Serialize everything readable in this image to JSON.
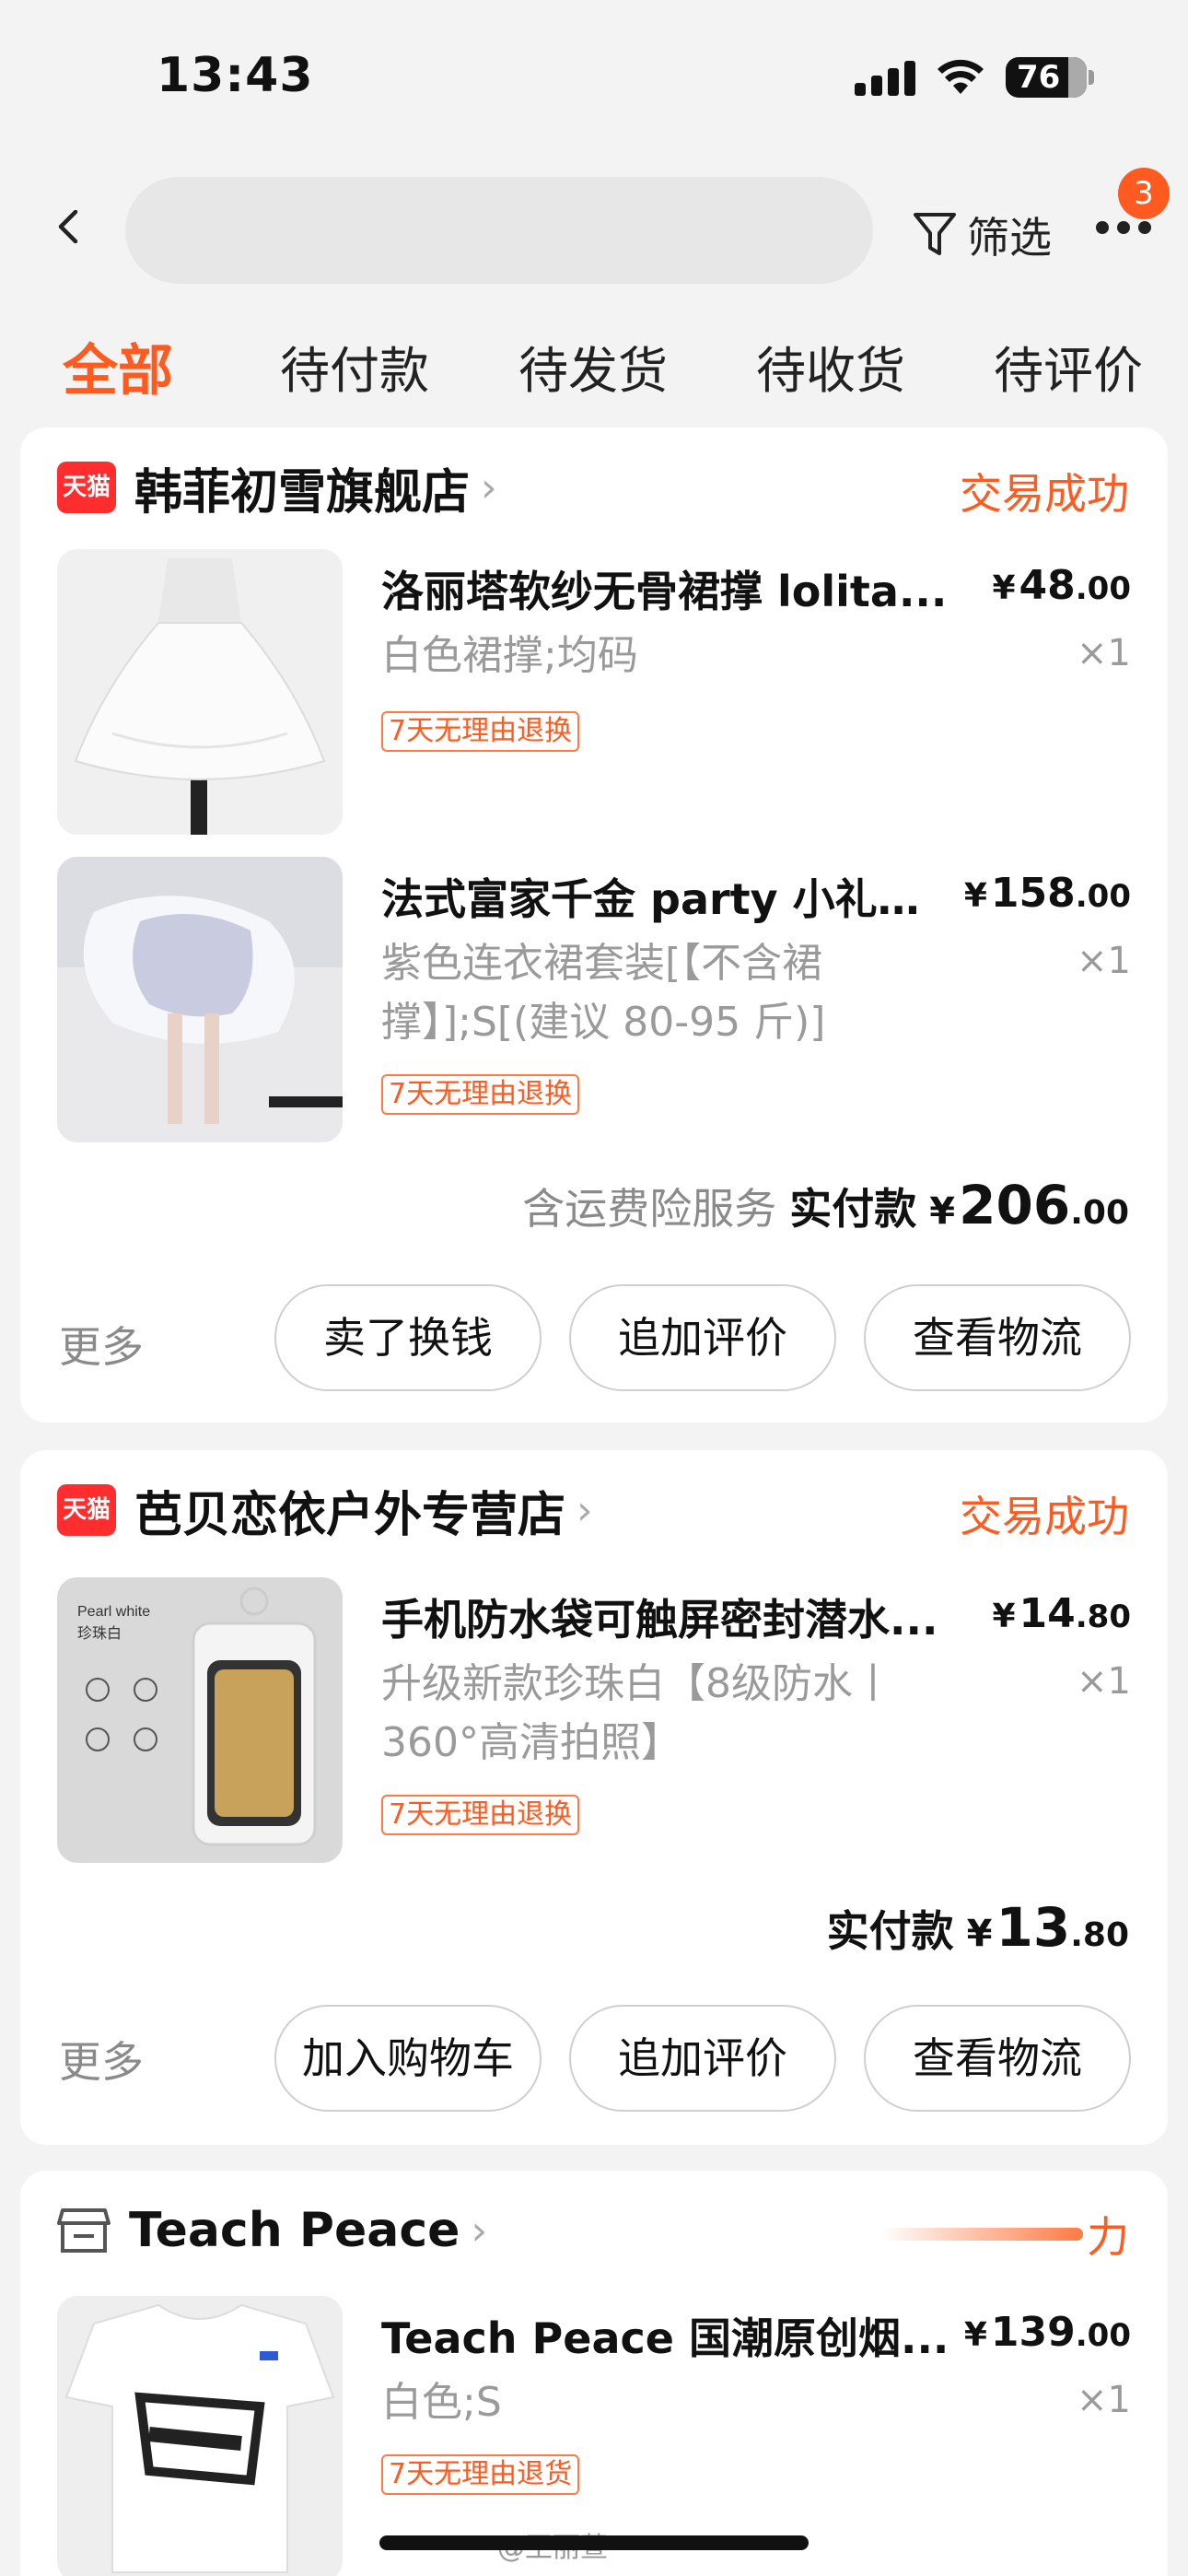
{
  "status_bar": {
    "time": "13:43",
    "battery": "76"
  },
  "header": {
    "back_icon": "chevron-left-icon",
    "search_placeholder": "",
    "filter_label": "筛选",
    "more_badge": "3"
  },
  "tabs": [
    {
      "label": "全部",
      "active": true
    },
    {
      "label": "待付款",
      "active": false
    },
    {
      "label": "待发货",
      "active": false
    },
    {
      "label": "待收货",
      "active": false
    },
    {
      "label": "待评价",
      "active": false
    }
  ],
  "orders": [
    {
      "platform_badge": "天猫",
      "shop": "韩菲初雪旗舰店",
      "status": "交易成功",
      "items": [
        {
          "title": "洛丽塔软纱无骨裙撑 lolita...",
          "price_int": "48",
          "price_dec": ".00",
          "spec": "白色裙撑;均码",
          "qty": "×1",
          "tag": "7天无理由退换"
        },
        {
          "title": "法式富家千金 party 小礼服...",
          "price_int": "158",
          "price_dec": ".00",
          "spec": "紫色连衣裙套装[【不含裙撑】];S[(建议 80-95 斤)]",
          "qty": "×1",
          "tag": "7天无理由退换"
        }
      ],
      "insurance": "含运费险服务",
      "paid_label": "实付款",
      "paid_int": "206",
      "paid_dec": ".00",
      "more": "更多",
      "buttons": [
        "卖了换钱",
        "追加评价",
        "查看物流"
      ]
    },
    {
      "platform_badge": "天猫",
      "shop": "芭贝恋依户外专营店",
      "status": "交易成功",
      "items": [
        {
          "title": "手机防水袋可触屏密封潜水...",
          "price_int": "14",
          "price_dec": ".80",
          "spec": "升级新款珍珠白【8级防水丨360°高清拍照】",
          "qty": "×1",
          "tag": "7天无理由退换"
        }
      ],
      "product_image_text": {
        "line1": "Pearl white",
        "line2": "珍珠白"
      },
      "paid_label": "实付款",
      "paid_int": "13",
      "paid_dec": ".80",
      "more": "更多",
      "buttons": [
        "加入购物车",
        "追加评价",
        "查看物流"
      ]
    },
    {
      "shop": "Teach Peace",
      "status": "力",
      "items": [
        {
          "title": "Teach Peace 国潮原创烟...",
          "price_int": "139",
          "price_dec": ".00",
          "spec": "白色;S",
          "qty": "×1",
          "tag": "7天无理由退货"
        }
      ]
    }
  ],
  "currency": "¥",
  "watermark": "@王丽萱",
  "colors": {
    "accent": "#ff5a1f",
    "tmall": "#ff2d2d",
    "background": "#f3f3f3"
  }
}
